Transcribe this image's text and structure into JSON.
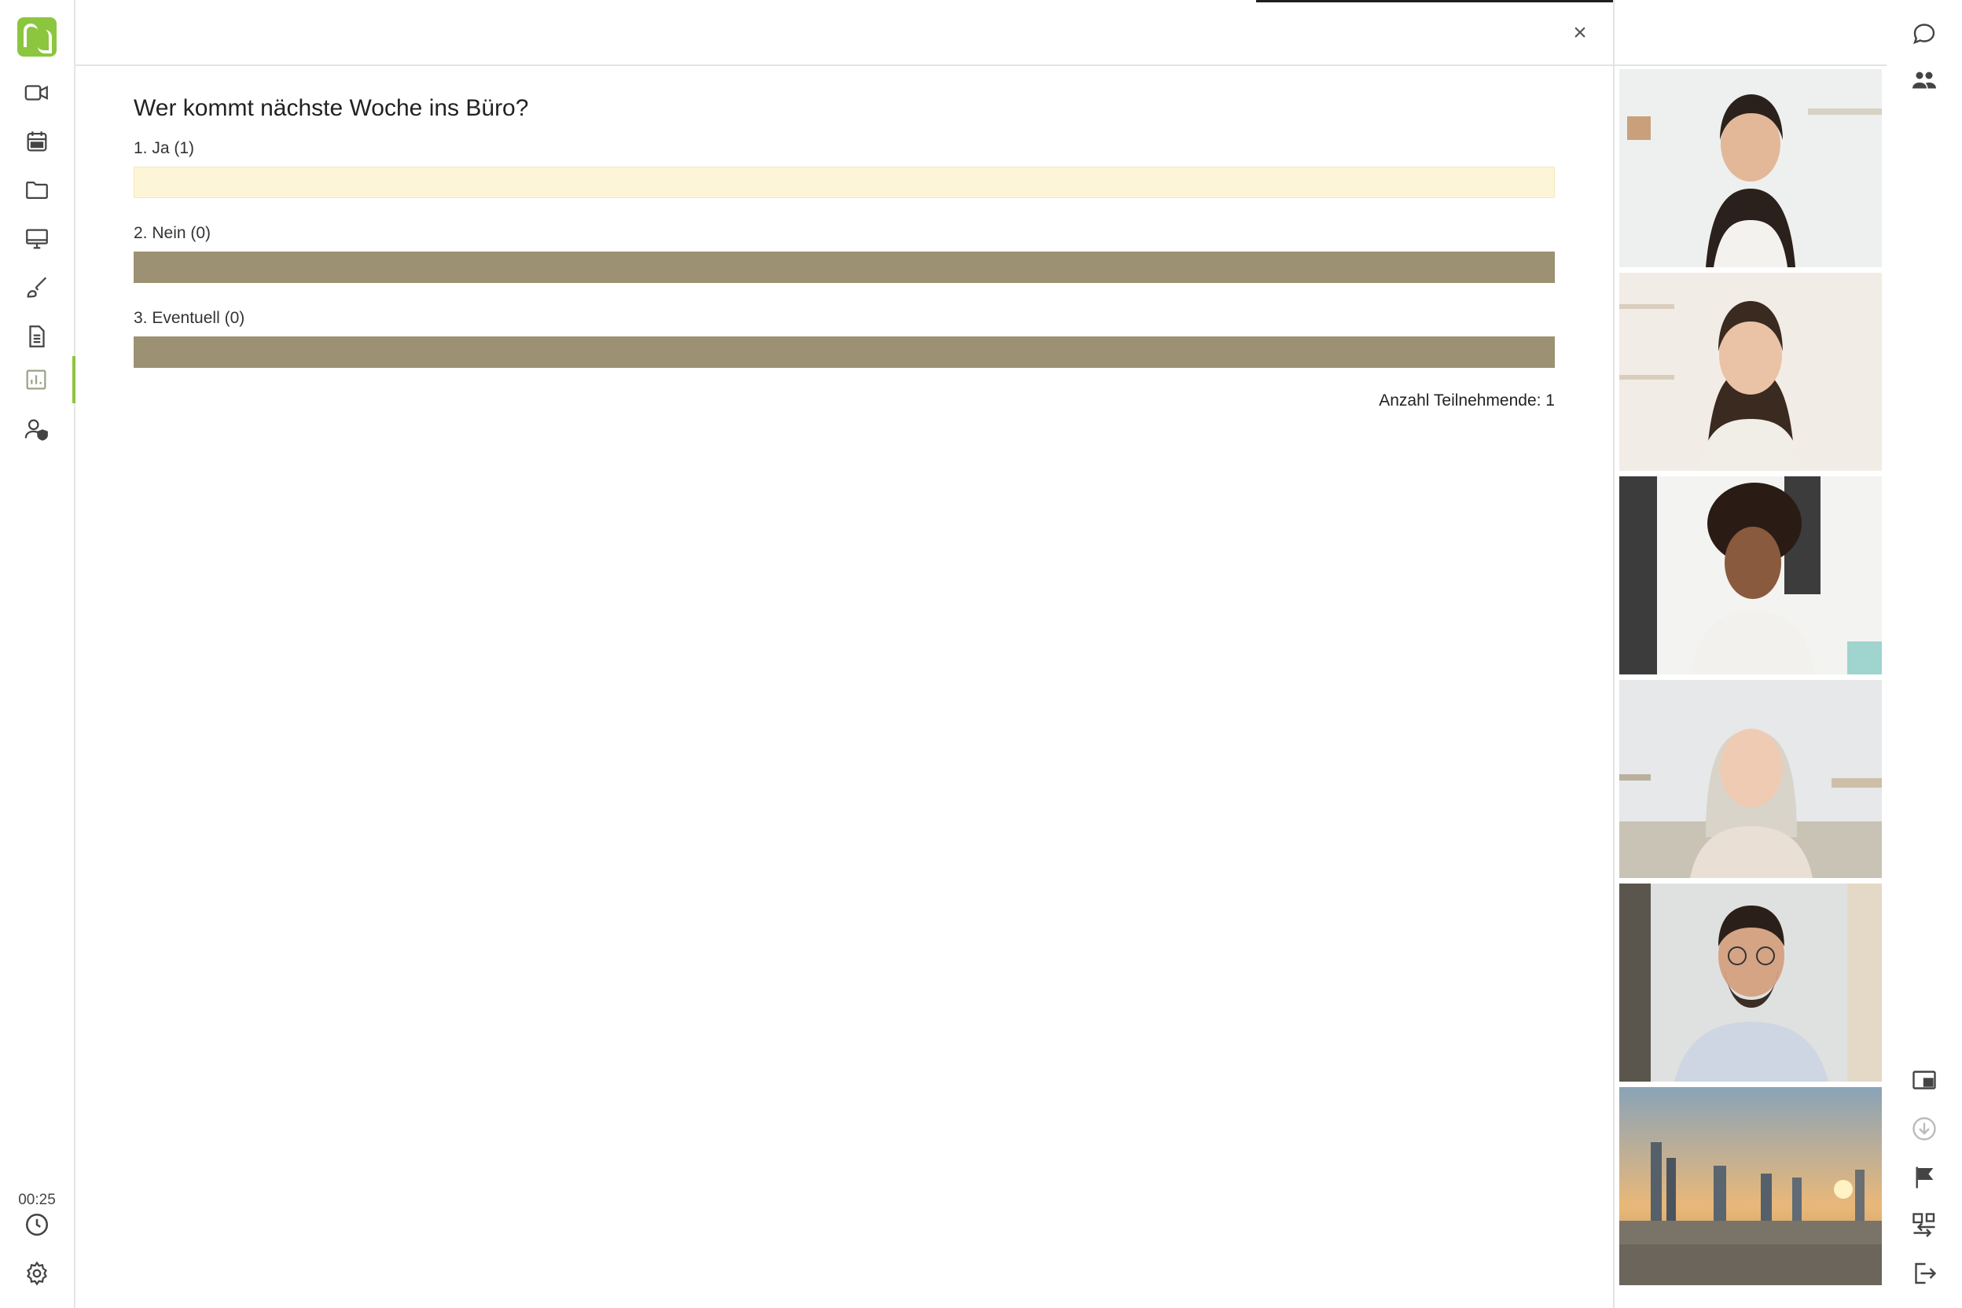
{
  "sidebar": {
    "items": [
      {
        "name": "video-camera-icon"
      },
      {
        "name": "calendar-icon"
      },
      {
        "name": "folder-icon"
      },
      {
        "name": "desktop-icon"
      },
      {
        "name": "brush-icon"
      },
      {
        "name": "document-icon"
      },
      {
        "name": "poll-chart-icon",
        "active": true
      },
      {
        "name": "user-shield-icon"
      }
    ],
    "timer": "00:25",
    "bottom_icons": [
      "clock-icon",
      "gear-icon"
    ]
  },
  "toolbar": {
    "close_label": "×"
  },
  "poll": {
    "question": "Wer kommt nächste Woche ins Büro?",
    "options": [
      {
        "label": "1. Ja (1)",
        "votes": 1,
        "fill": 1.0
      },
      {
        "label": "2. Nein (0)",
        "votes": 0,
        "fill": 0.0
      },
      {
        "label": "3. Eventuell (0)",
        "votes": 0,
        "fill": 0.0
      }
    ],
    "participants": "Anzahl Teilnehmende: 1",
    "colors": {
      "leading": "#fdf5d7",
      "other": "#9c9172",
      "accent": "#8cc63f"
    }
  },
  "videos": [
    {
      "name": "participant-1"
    },
    {
      "name": "participant-2"
    },
    {
      "name": "participant-3"
    },
    {
      "name": "participant-4"
    },
    {
      "name": "participant-5"
    },
    {
      "name": "city-skyline-background"
    }
  ],
  "right_actions": {
    "top": [
      "chat-icon",
      "participants-icon"
    ],
    "bottom": [
      "picture-in-picture-icon",
      "download-icon",
      "flag-icon",
      "switch-layout-icon",
      "leave-icon"
    ]
  }
}
